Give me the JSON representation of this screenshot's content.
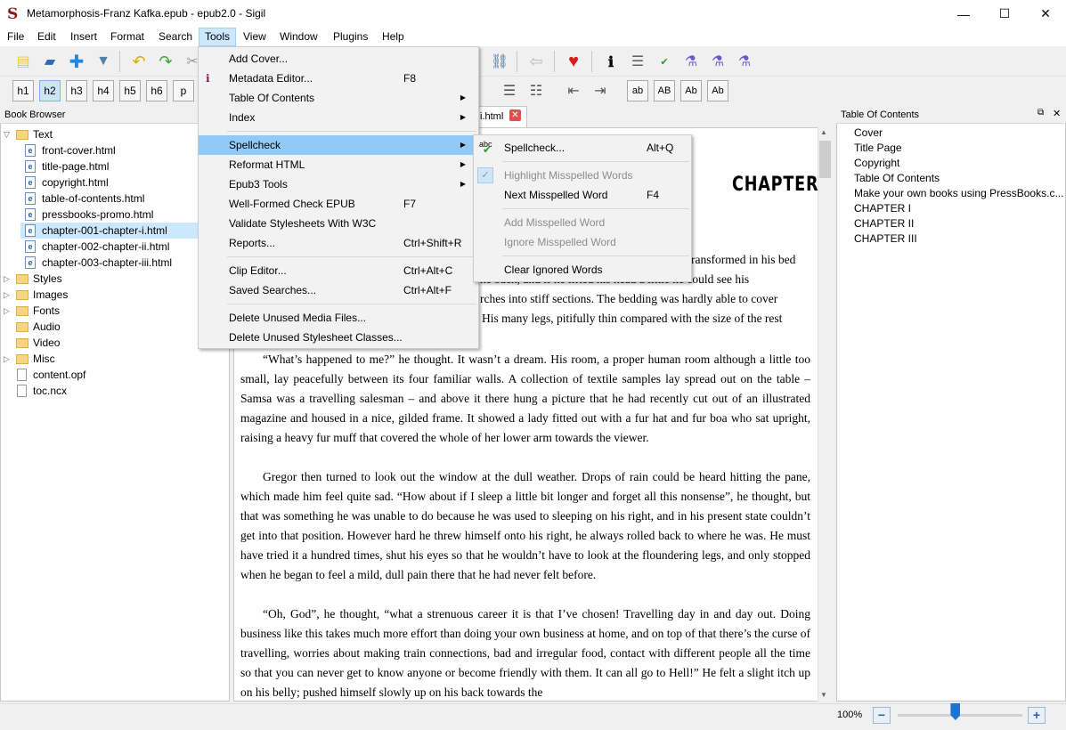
{
  "window": {
    "title": "Metamorphosis-Franz Kafka.epub - epub2.0 - Sigil",
    "logo_glyph": "S",
    "minimize": "—",
    "maximize": "☐",
    "close": "✕"
  },
  "menubar": [
    "File",
    "Edit",
    "Insert",
    "Format",
    "Search",
    "Tools",
    "View",
    "Window",
    "Plugins",
    "Help"
  ],
  "toolbar": {
    "heading_buttons": [
      "h1",
      "h2",
      "h3",
      "h4",
      "h5",
      "h6",
      "p"
    ],
    "case_buttons": [
      "ab",
      "AB",
      "Ab",
      "Ab"
    ]
  },
  "book_browser": {
    "title": "Book Browser",
    "text_folder": "Text",
    "text_files": [
      "front-cover.html",
      "title-page.html",
      "copyright.html",
      "table-of-contents.html",
      "pressbooks-promo.html",
      "chapter-001-chapter-i.html",
      "chapter-002-chapter-ii.html",
      "chapter-003-chapter-iii.html"
    ],
    "folders": [
      "Styles",
      "Images",
      "Fonts",
      "Audio",
      "Video",
      "Misc"
    ],
    "root_files": [
      "content.opf",
      "toc.ncx"
    ]
  },
  "editor": {
    "tab_label": "i.html",
    "tab_close": "✕",
    "chapter_heading": "CHAPTER I",
    "fragments": [
      "ransformed in his bed",
      "ke back, and if he lifted his head a little he could see his",
      "rches into stiff sections. The bedding was hardly able to cover",
      "His many legs, pitifully thin compared with the size of the rest"
    ],
    "paragraphs": [
      "“What’s happened to me?” he thought. It wasn’t a dream. His room, a proper human room although a little too small, lay peacefully between its four familiar walls. A collection of textile samples lay spread out on the table – Samsa was a travelling salesman – and above it there hung a picture that he had recently cut out of an illustrated magazine and housed in a nice, gilded frame. It showed a lady fitted out with a fur hat and fur boa who sat upright, raising a heavy fur muff that covered the whole of her lower arm towards the viewer.",
      "Gregor then turned to look out the window at the dull weather. Drops of rain could be heard hitting the pane, which made him feel quite sad. “How about if I sleep a little bit longer and forget all this nonsense”, he thought, but that was something he was unable to do because he was used to sleeping on his right, and in his present state couldn’t get into that position. However hard he threw himself onto his right, he always rolled back to where he was. He must have tried it a hundred times, shut his eyes so that he wouldn’t have to look at the floundering legs, and only stopped when he began to feel a mild, dull pain there that he had never felt before.",
      "“Oh, God”, he thought, “what a strenuous career it is that I’ve chosen! Travelling day in and day out. Doing business like this takes much more effort than doing your own business at home, and on top of that there’s the curse of travelling, worries about making train connections, bad and irregular food, contact with different people all the time so that you can never get to know anyone or become friendly with them. It can all go to Hell!” He felt a slight itch up on his belly; pushed himself slowly up on his back towards the"
    ]
  },
  "toc": {
    "title": "Table Of Contents",
    "items": [
      "Cover",
      "Title Page",
      "Copyright",
      "Table Of Contents",
      "Make your own books using PressBooks.c...",
      "CHAPTER I",
      "CHAPTER II",
      "CHAPTER III"
    ]
  },
  "status": {
    "zoom": "100%",
    "zoom_out": "−",
    "zoom_in": "+",
    "zoom_level": 0.46
  },
  "tools_menu": {
    "items": [
      {
        "label": "Add Cover...",
        "shortcut": ""
      },
      {
        "label": "Metadata Editor...",
        "shortcut": "F8"
      },
      {
        "label": "Table Of Contents",
        "shortcut": "",
        "submenu": true
      },
      {
        "label": "Index",
        "shortcut": "",
        "submenu": true
      },
      {
        "label": "Spellcheck",
        "shortcut": "",
        "submenu": true
      },
      {
        "label": "Reformat HTML",
        "shortcut": "",
        "submenu": true
      },
      {
        "label": "Epub3 Tools",
        "shortcut": "",
        "submenu": true
      },
      {
        "label": "Well-Formed Check EPUB",
        "shortcut": "F7"
      },
      {
        "label": "Validate Stylesheets With W3C",
        "shortcut": ""
      },
      {
        "label": "Reports...",
        "shortcut": "Ctrl+Shift+R"
      },
      {
        "label": "Clip Editor...",
        "shortcut": "Ctrl+Alt+C"
      },
      {
        "label": "Saved Searches...",
        "shortcut": "Ctrl+Alt+F"
      },
      {
        "label": "Delete Unused Media Files...",
        "shortcut": ""
      },
      {
        "label": "Delete Unused Stylesheet Classes...",
        "shortcut": ""
      }
    ]
  },
  "spellcheck_menu": {
    "items": [
      {
        "label": "Spellcheck...",
        "shortcut": "Alt+Q"
      },
      {
        "label": "Highlight Misspelled Words",
        "shortcut": ""
      },
      {
        "label": "Next Misspelled Word",
        "shortcut": "F4"
      },
      {
        "label": "Add Misspelled Word",
        "shortcut": ""
      },
      {
        "label": "Ignore Misspelled Word",
        "shortcut": ""
      },
      {
        "label": "Clear Ignored Words",
        "shortcut": ""
      }
    ]
  },
  "colors": {
    "highlight": "#91c9f7",
    "selection": "#cce8ff",
    "accent": "#1e73d2"
  }
}
